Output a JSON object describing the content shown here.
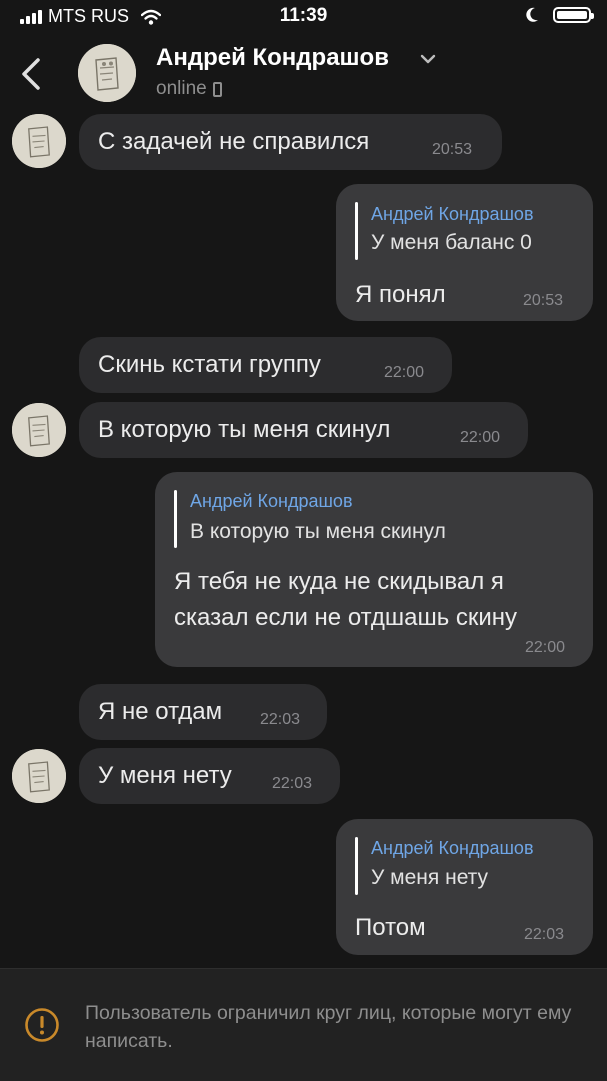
{
  "status_bar": {
    "carrier": "MTS RUS",
    "time": "11:39"
  },
  "header": {
    "contact_name": "Андрей Кондрашов",
    "status": "online"
  },
  "messages": [
    {
      "direction": "in",
      "text": "С задачей не справился",
      "time": "20:53"
    },
    {
      "direction": "out",
      "reply_to": {
        "name": "Андрей Кондрашов",
        "text": "У меня баланс 0"
      },
      "text": "Я понял",
      "time": "20:53"
    },
    {
      "direction": "in",
      "text": "Скинь кстати группу",
      "time": "22:00"
    },
    {
      "direction": "in",
      "text": "В которую ты меня скинул",
      "time": "22:00"
    },
    {
      "direction": "out",
      "reply_to": {
        "name": "Андрей Кондрашов",
        "text": "В которую ты меня скинул"
      },
      "text_lines": [
        "Я тебя не куда не скидывал я",
        "сказал если не отдшашь скину"
      ],
      "time": "22:00"
    },
    {
      "direction": "in",
      "text": "Я не отдам",
      "time": "22:03"
    },
    {
      "direction": "in",
      "text": "У меня нету",
      "time": "22:03"
    },
    {
      "direction": "out",
      "reply_to": {
        "name": "Андрей Кондрашов",
        "text": "У меня нету"
      },
      "text": "Потом",
      "time": "22:03"
    }
  ],
  "footer": {
    "notice": "Пользователь ограничил круг лиц, которые могут ему написать."
  },
  "colors": {
    "background": "#161616",
    "incoming_bubble": "#2c2c2e",
    "outgoing_bubble": "#3a3a3c",
    "quote_name": "#6fa6e6",
    "warning_icon": "#c9892a"
  },
  "icons": [
    "signal-icon",
    "wifi-icon",
    "moon-icon",
    "battery-icon",
    "back-icon",
    "chevron-down-icon",
    "phone-icon",
    "warning-icon"
  ]
}
